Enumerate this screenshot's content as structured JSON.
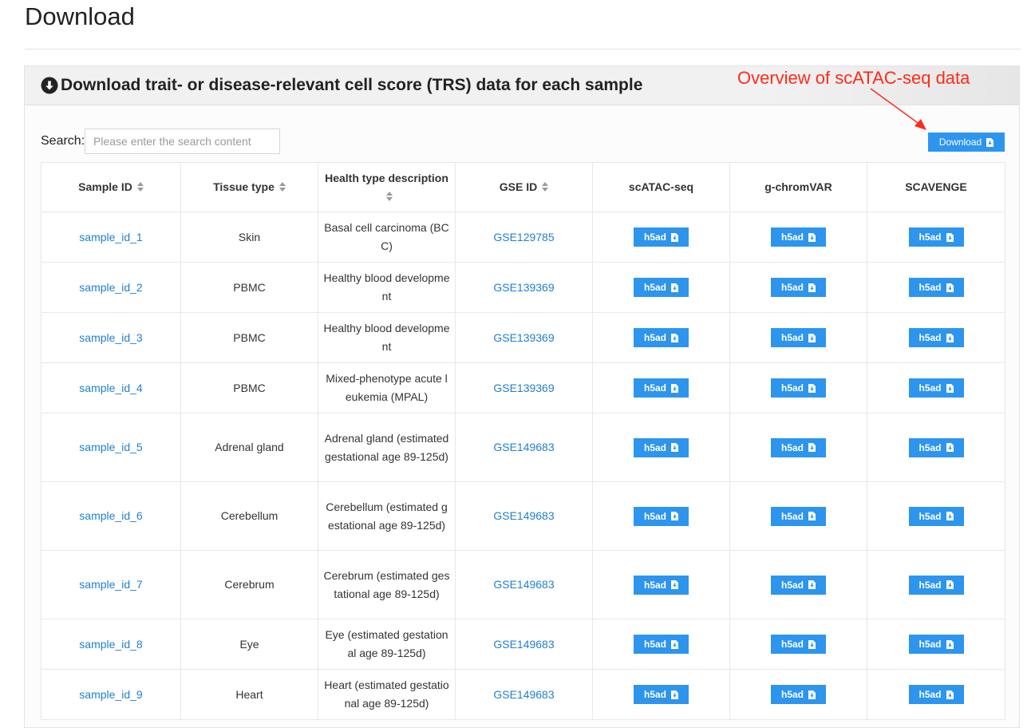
{
  "page": {
    "title": "Download"
  },
  "panel": {
    "title": "Download trait- or disease-relevant cell score (TRS) data for each sample",
    "annotation": "Overview of scATAC-seq data"
  },
  "search": {
    "label": "Search:",
    "placeholder": "Please enter the search content",
    "value": ""
  },
  "download_button": {
    "label": "Download"
  },
  "table": {
    "headers": [
      "Sample ID",
      "Tissue type",
      "Health type description",
      "GSE ID",
      "scATAC-seq",
      "g-chromVAR",
      "SCAVENGE"
    ],
    "button_label": "h5ad",
    "rows": [
      {
        "sample_id": "sample_id_1",
        "tissue": "Skin",
        "description": "Basal cell carcinoma (BCC)",
        "gse": "GSE129785"
      },
      {
        "sample_id": "sample_id_2",
        "tissue": "PBMC",
        "description": "Healthy blood development",
        "gse": "GSE139369"
      },
      {
        "sample_id": "sample_id_3",
        "tissue": "PBMC",
        "description": "Healthy blood development",
        "gse": "GSE139369"
      },
      {
        "sample_id": "sample_id_4",
        "tissue": "PBMC",
        "description": "Mixed-phenotype acute leukemia (MPAL)",
        "gse": "GSE139369"
      },
      {
        "sample_id": "sample_id_5",
        "tissue": "Adrenal gland",
        "description": "Adrenal gland (estimated gestational age 89-125d)",
        "gse": "GSE149683"
      },
      {
        "sample_id": "sample_id_6",
        "tissue": "Cerebellum",
        "description": "Cerebellum (estimated gestational age 89-125d)",
        "gse": "GSE149683"
      },
      {
        "sample_id": "sample_id_7",
        "tissue": "Cerebrum",
        "description": "Cerebrum (estimated gestational age 89-125d)",
        "gse": "GSE149683"
      },
      {
        "sample_id": "sample_id_8",
        "tissue": "Eye",
        "description": "Eye (estimated gestational age 89-125d)",
        "gse": "GSE149683"
      },
      {
        "sample_id": "sample_id_9",
        "tissue": "Heart",
        "description": "Heart (estimated gestational age 89-125d)",
        "gse": "GSE149683"
      }
    ]
  },
  "colors": {
    "link": "#1f7fd3",
    "button": "#2d95ee",
    "annotation": "#ff2a1a"
  }
}
